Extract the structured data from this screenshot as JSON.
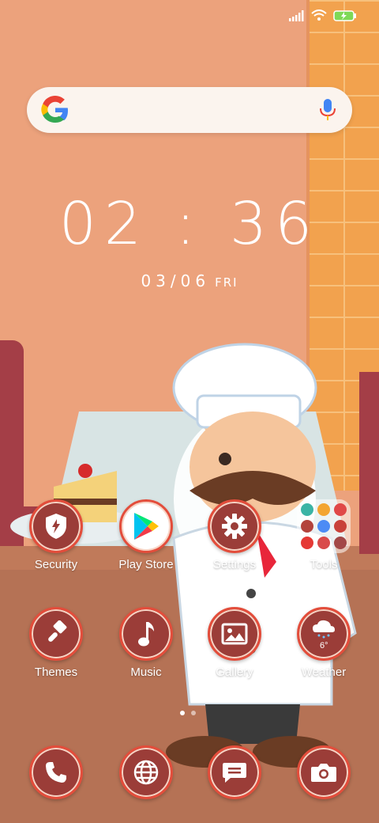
{
  "status_bar": {
    "icons": [
      "signal-icon",
      "wifi-icon",
      "battery-charging-icon"
    ]
  },
  "search": {
    "logo": "google-logo",
    "icon": "mic-icon"
  },
  "clock": {
    "time": "02 : 36",
    "date": "03/06",
    "day": "FRI"
  },
  "apps": [
    {
      "label": "Security",
      "icon": "shield-bolt-icon"
    },
    {
      "label": "Play Store",
      "icon": "play-store-icon"
    },
    {
      "label": "Settings",
      "icon": "gear-icon"
    },
    {
      "label": "Tools",
      "icon": "folder-icon"
    },
    {
      "label": "Themes",
      "icon": "paintbrush-icon"
    },
    {
      "label": "Music",
      "icon": "music-note-icon"
    },
    {
      "label": "Gallery",
      "icon": "image-icon"
    },
    {
      "label": "Weather",
      "icon": "cloud-rain-icon",
      "temp": "6°"
    }
  ],
  "dock": [
    {
      "icon": "phone-icon"
    },
    {
      "icon": "globe-icon"
    },
    {
      "icon": "message-icon"
    },
    {
      "icon": "camera-icon"
    }
  ],
  "page_indicator": {
    "pages": 2,
    "active": 1
  },
  "colors": {
    "wall": "#ECA27C",
    "icon_bg": "#9B3D38",
    "icon_ring": "#E34D3B"
  }
}
